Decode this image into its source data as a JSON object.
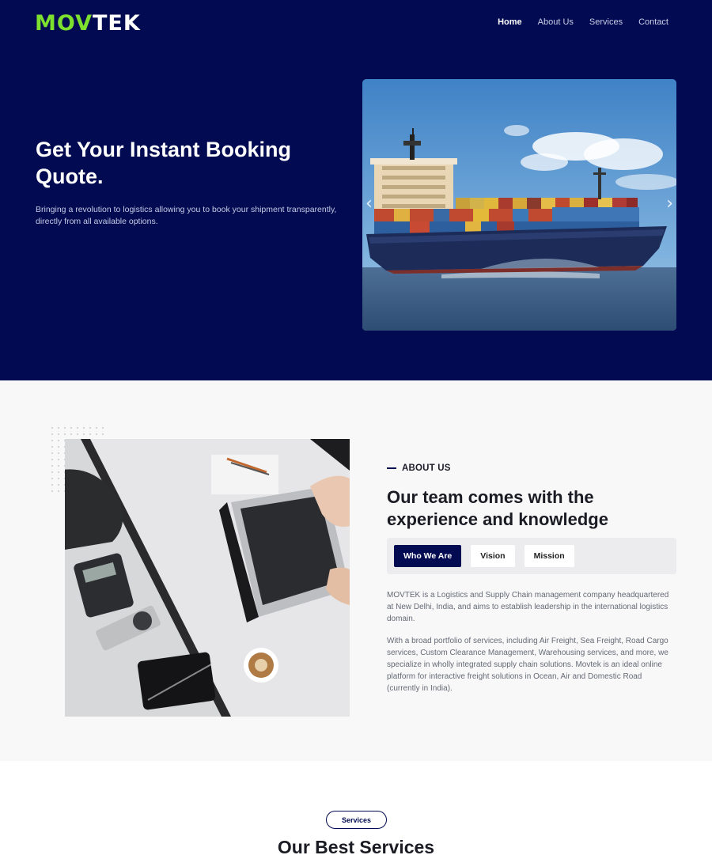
{
  "header": {
    "logo_part1": "MOV",
    "logo_part2": "TEK",
    "nav": [
      {
        "label": "Home",
        "active": true
      },
      {
        "label": "About Us",
        "active": false
      },
      {
        "label": "Services",
        "active": false
      },
      {
        "label": "Contact",
        "active": false
      }
    ]
  },
  "hero": {
    "title": "Get Your Instant Booking Quote.",
    "subtitle": "Bringing a revolution to logistics allowing you to book your shipment transparently, directly from all available options.",
    "slider": {
      "prev_icon": "chevron-left-icon",
      "next_icon": "chevron-right-icon",
      "image": "container-ship-photo"
    }
  },
  "about": {
    "eyebrow": "ABOUT US",
    "title": "Our team comes with the experience and knowledge",
    "tabs": [
      {
        "label": "Who We Are",
        "active": true
      },
      {
        "label": "Vision",
        "active": false
      },
      {
        "label": "Mission",
        "active": false
      }
    ],
    "paragraphs": [
      "MOVTEK is a Logistics and Supply Chain management company headquartered at New Delhi, India, and aims to establish leadership in the international logistics domain.",
      "With a broad portfolio of services, including Air Freight, Sea Freight, Road Cargo services, Custom Clearance Management, Warehousing services, and more, we specialize in wholly integrated supply chain solutions. Movtek is an ideal online platform for interactive freight solutions in Ocean, Air and Domestic Road (currently in India)."
    ],
    "image": "office-desk-laptop-photo"
  },
  "services": {
    "pill": "Services",
    "title": "Our Best Services"
  },
  "colors": {
    "navy": "#020b51",
    "logo_green": "#7ee02e",
    "section_gray": "#f8f8f9"
  }
}
